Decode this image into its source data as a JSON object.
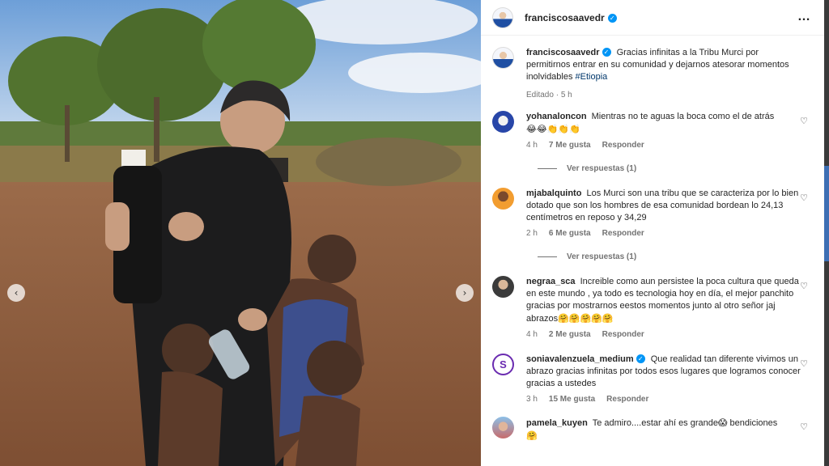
{
  "post": {
    "author": "franciscosaavedr",
    "caption": "Gracias infinitas a la Tribu Murci por permitirnos entrar en su comunidad y dejarnos atesorar momentos inolvidables",
    "hashtag": "#Etiopia",
    "edited": "Editado",
    "time": "5 h",
    "more_icon": "…",
    "prev_icon": "‹",
    "next_icon": "›"
  },
  "comments": [
    {
      "user": "yohanaloncon",
      "text": "Mientras no te aguas la boca como el de atrás",
      "emoji": "😂😂👏👏👏",
      "time": "4 h",
      "likes": "7 Me gusta",
      "reply": "Responder",
      "view_replies": "Ver respuestas (1)"
    },
    {
      "user": "mjabalquinto",
      "text": "Los Murci son una tribu que se caracteriza por lo bien dotado que son los hombres de esa comunidad bordean lo 24,13 centímetros en reposo y 34,29",
      "time": "2 h",
      "likes": "6 Me gusta",
      "reply": "Responder",
      "view_replies": "Ver respuestas (1)"
    },
    {
      "user": "negraa_sca",
      "text": "Increible como aun persistee la poca cultura que queda en este mundo , ya todo es tecnologia hoy en día, el mejor panchito gracias por mostrarnos eestos momentos junto al otro señor jaj abrazos",
      "emoji": "🤗🤗🤗🤗🤗",
      "time": "4 h",
      "likes": "2 Me gusta",
      "reply": "Responder"
    },
    {
      "user": "soniavalenzuela_medium",
      "avatar_letter": "S",
      "text": "Que realidad tan diferente vivimos un abrazo gracias infinitas por todos esos lugares que logramos conocer gracias a ustedes",
      "time": "3 h",
      "likes": "15 Me gusta",
      "reply": "Responder"
    },
    {
      "user": "pamela_kuyen",
      "text": "Te admiro....estar ahí es grande",
      "emoji_mid": "😱",
      "text2": "bendiciones",
      "emoji2": "🤗"
    }
  ],
  "icons": {
    "heart": "♡",
    "verified": "✓"
  },
  "colors": {
    "verified": "#0095f6",
    "hashtag": "#00376b",
    "meta_gray": "#737373"
  }
}
